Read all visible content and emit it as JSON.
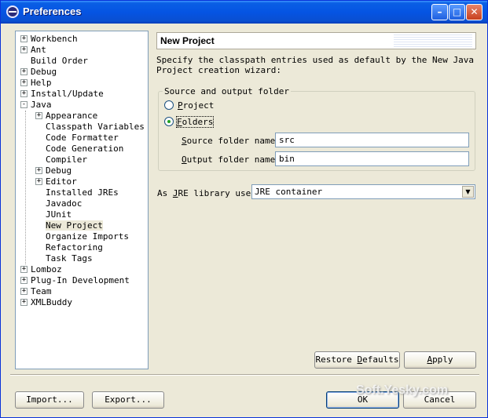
{
  "window": {
    "title": "Preferences",
    "minimize_glyph": "–",
    "maximize_glyph": "□",
    "close_glyph": "✕"
  },
  "tree": {
    "items": [
      {
        "label": "Workbench",
        "expander": "+"
      },
      {
        "label": "Ant",
        "expander": "+"
      },
      {
        "label": "Build Order",
        "expander": ""
      },
      {
        "label": "Debug",
        "expander": "+"
      },
      {
        "label": "Help",
        "expander": "+"
      },
      {
        "label": "Install/Update",
        "expander": "+"
      },
      {
        "label": "Java",
        "expander": "-"
      },
      {
        "label": "Appearance",
        "expander": "+"
      },
      {
        "label": "Classpath Variables",
        "expander": ""
      },
      {
        "label": "Code Formatter",
        "expander": ""
      },
      {
        "label": "Code Generation",
        "expander": ""
      },
      {
        "label": "Compiler",
        "expander": ""
      },
      {
        "label": "Debug",
        "expander": "+"
      },
      {
        "label": "Editor",
        "expander": "+"
      },
      {
        "label": "Installed JREs",
        "expander": ""
      },
      {
        "label": "Javadoc",
        "expander": ""
      },
      {
        "label": "JUnit",
        "expander": ""
      },
      {
        "label": "New Project",
        "expander": ""
      },
      {
        "label": "Organize Imports",
        "expander": ""
      },
      {
        "label": "Refactoring",
        "expander": ""
      },
      {
        "label": "Task Tags",
        "expander": ""
      },
      {
        "label": "Lomboz",
        "expander": "+"
      },
      {
        "label": "Plug-In Development",
        "expander": "+"
      },
      {
        "label": "Team",
        "expander": "+"
      },
      {
        "label": "XMLBuddy",
        "expander": "+"
      }
    ]
  },
  "page": {
    "title": "New Project",
    "description_line1": "Specify the classpath entries used as default by the New Java",
    "description_line2": "Project creation wizard:",
    "group_title": "Source and output folder",
    "radio_project": {
      "mnemonic": "P",
      "rest": "roject",
      "checked": false
    },
    "radio_folders": {
      "mnemonic": "F",
      "rest": "olders",
      "checked": true
    },
    "source_label": {
      "mnemonic": "S",
      "rest": "ource folder name:"
    },
    "source_value": "src",
    "output_label": {
      "mnemonic": "O",
      "rest": "utput folder name:"
    },
    "output_value": "bin",
    "jre_label": {
      "before": "As ",
      "mnemonic": "J",
      "rest": "RE library use:"
    },
    "jre_value": "JRE container",
    "combo_arrow": "▼"
  },
  "buttons": {
    "restore": {
      "before": "Restore ",
      "mnemonic": "D",
      "rest": "efaults"
    },
    "apply": {
      "mnemonic": "A",
      "rest": "pply"
    },
    "import": "Import...",
    "export": "Export...",
    "ok": "OK",
    "cancel": "Cancel"
  },
  "watermark": "Soft.Yesky.com"
}
